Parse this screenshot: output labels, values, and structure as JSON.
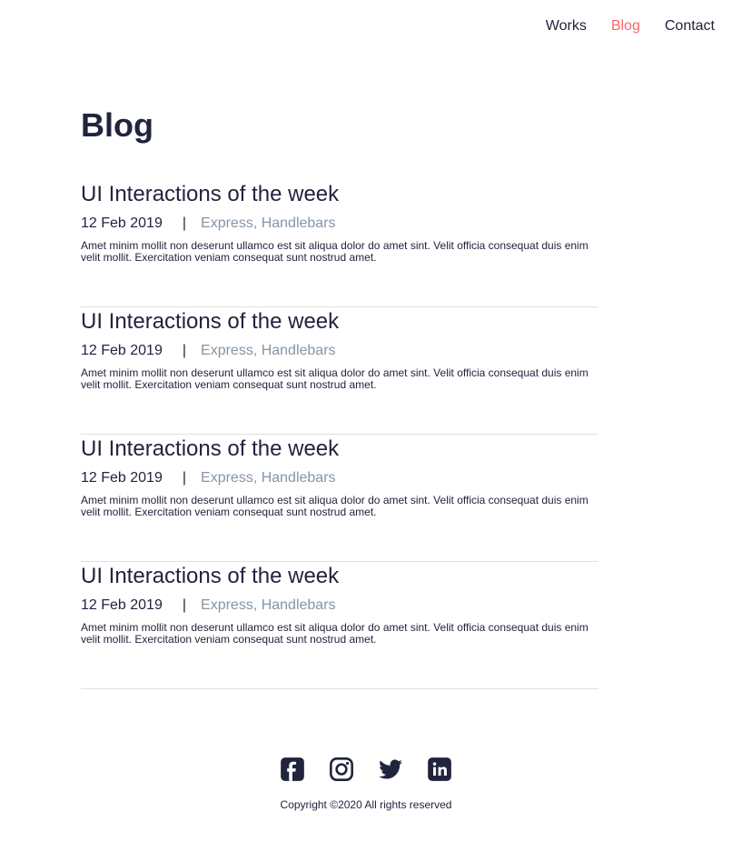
{
  "nav": {
    "items": [
      {
        "label": "Works",
        "active": false
      },
      {
        "label": "Blog",
        "active": true
      },
      {
        "label": "Contact",
        "active": false
      }
    ]
  },
  "page": {
    "title": "Blog"
  },
  "posts": [
    {
      "title": "UI Interactions of the week",
      "date": "12 Feb 2019",
      "separator": "|",
      "tags": "Express, Handlebars",
      "excerpt": "Amet minim mollit non deserunt ullamco est sit aliqua dolor do amet sint. Velit officia consequat duis enim velit mollit. Exercitation veniam consequat sunt nostrud amet."
    },
    {
      "title": "UI Interactions of the week",
      "date": "12 Feb 2019",
      "separator": "|",
      "tags": "Express, Handlebars",
      "excerpt": "Amet minim mollit non deserunt ullamco est sit aliqua dolor do amet sint. Velit officia consequat duis enim velit mollit. Exercitation veniam consequat sunt nostrud amet."
    },
    {
      "title": "UI Interactions of the week",
      "date": "12 Feb 2019",
      "separator": "|",
      "tags": "Express, Handlebars",
      "excerpt": "Amet minim mollit non deserunt ullamco est sit aliqua dolor do amet sint. Velit officia consequat duis enim velit mollit. Exercitation veniam consequat sunt nostrud amet."
    },
    {
      "title": "UI Interactions of the week",
      "date": "12 Feb 2019",
      "separator": "|",
      "tags": "Express, Handlebars",
      "excerpt": "Amet minim mollit non deserunt ullamco est sit aliqua dolor do amet sint. Velit officia consequat duis enim velit mollit. Exercitation veniam consequat sunt nostrud amet."
    }
  ],
  "footer": {
    "socials": [
      "facebook-icon",
      "instagram-icon",
      "twitter-icon",
      "linkedin-icon"
    ],
    "copyright": "Copyright ©2020 All rights reserved"
  },
  "colors": {
    "text": "#21243d",
    "accent": "#ff6464",
    "muted": "#8695a4",
    "divider": "#e0e0e0"
  }
}
